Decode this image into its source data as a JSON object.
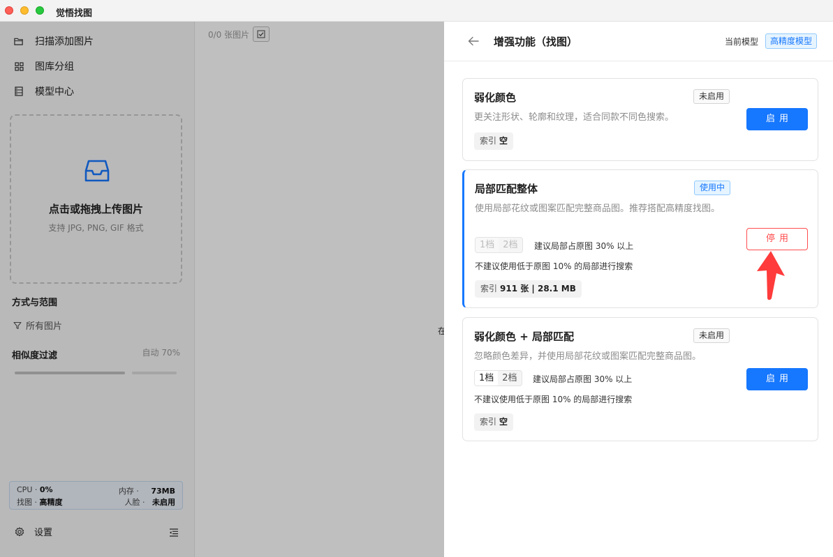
{
  "window": {
    "title": "觉悟找图"
  },
  "sidebar": {
    "nav": [
      {
        "label": "扫描添加图片",
        "icon": "folder-icon"
      },
      {
        "label": "图库分组",
        "icon": "grid-icon"
      },
      {
        "label": "模型中心",
        "icon": "database-icon"
      }
    ],
    "upload": {
      "title": "点击或拖拽上传图片",
      "subtitle": "支持 JPG, PNG, GIF 格式"
    },
    "scope": {
      "title": "方式与范围",
      "filter_label": "所有图片"
    },
    "similarity": {
      "title": "相似度过滤",
      "auto_label": "自动 70%",
      "value": 0.7
    },
    "status": {
      "cpu_label": "CPU ·",
      "cpu_value": "0%",
      "mem_label": "内存 ·",
      "mem_value": "73MB",
      "search_label": "找图 ·",
      "search_value": "高精度",
      "face_label": "人脸 ·",
      "face_value": "未启用"
    },
    "settings_label": "设置"
  },
  "middle": {
    "count_label": "0/0 张图片",
    "clipped_text": "在"
  },
  "drawer": {
    "title": "增强功能（找图）",
    "current_model_label": "当前模型",
    "current_model_tag": "高精度模型",
    "cards": [
      {
        "title": "弱化颜色",
        "badge": "未启用",
        "desc": "更关注形状、轮廓和纹理，适合同款不同色搜索。",
        "button": "启用",
        "index_label": "索引",
        "index_value": "空"
      },
      {
        "title": "局部匹配整体",
        "badge": "使用中",
        "desc": "使用局部花纹或图案匹配完整商品图。推荐搭配高精度找图。",
        "seg": [
          "1档",
          "2档"
        ],
        "hint": "建议局部占原图 30% 以上",
        "hint2": "不建议使用低于原图 10% 的局部进行搜索",
        "button": "停用",
        "index_label": "索引",
        "index_value": "911 张 | 28.1 MB"
      },
      {
        "title": "弱化颜色 + 局部匹配",
        "badge": "未启用",
        "desc": "忽略颜色差异，并使用局部花纹或图案匹配完整商品图。",
        "seg": [
          "1档",
          "2档"
        ],
        "hint": "建议局部占原图 30% 以上",
        "hint2": "不建议使用低于原图 10% 的局部进行搜索",
        "button": "启用",
        "index_label": "索引",
        "index_value": "空"
      }
    ]
  },
  "colors": {
    "accent": "#1677ff",
    "danger": "#ff4d4f",
    "annotation_arrow": "#ff3b3b"
  }
}
